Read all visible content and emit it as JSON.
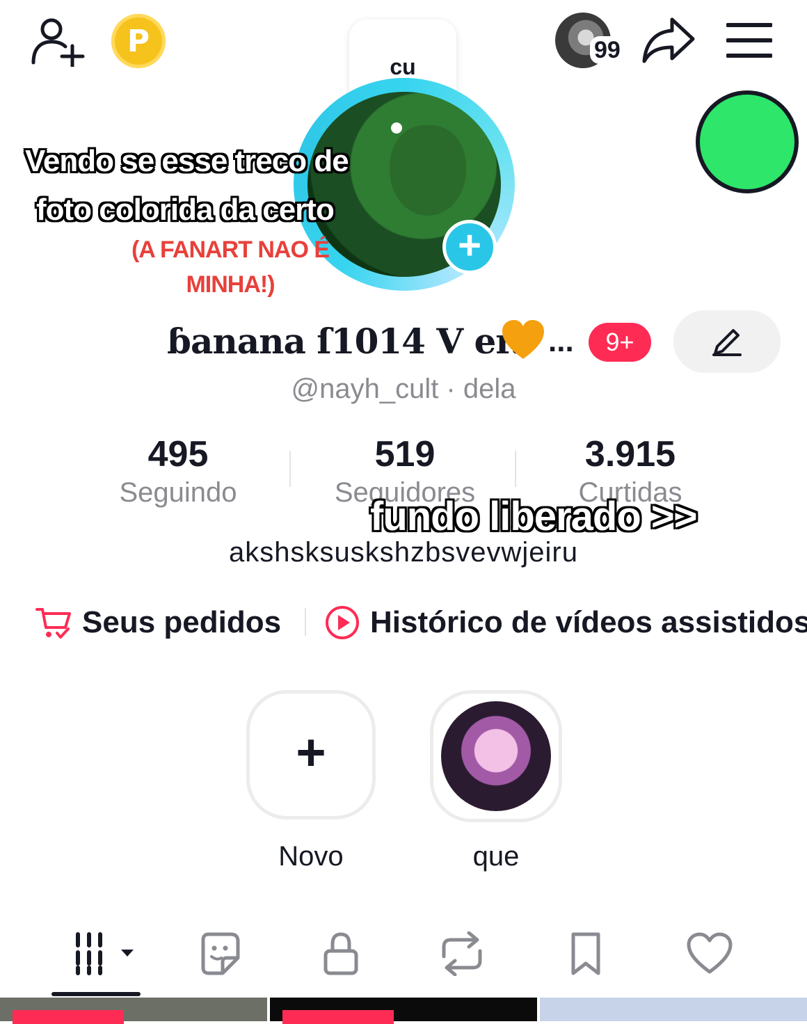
{
  "topbar": {
    "points_letter": "P",
    "friends_count": "99"
  },
  "note": {
    "text": "cu"
  },
  "overlay": {
    "caption_line1": "Vendo se esse treco de",
    "caption_line2": "foto colorida da certo",
    "caption_red": "(A FANART NAO É MINHA!)",
    "caption_fundo": "fundo liberado >>"
  },
  "profile": {
    "display_name": "ɓanana ſ1014 V er.",
    "ellipsis": "...",
    "badge": "9+",
    "handle": "@nayh_cult · dela",
    "bio": "akshsksuskshzbsvevwjeiru"
  },
  "stats": {
    "following": {
      "value": "495",
      "label": "Seguindo"
    },
    "followers": {
      "value": "519",
      "label": "Seguidores"
    },
    "likes": {
      "value": "3.915",
      "label": "Curtidas"
    }
  },
  "shortcuts": {
    "orders": "Seus pedidos",
    "history": "Histórico de vídeos assistidos"
  },
  "highlights": {
    "new_label": "Novo",
    "new_symbol": "+",
    "que_label": "que"
  },
  "icons": {
    "add_friend": "add-user-icon",
    "share": "share-icon",
    "menu": "hamburger-menu-icon",
    "edit": "pencil-icon",
    "orders": "cart-icon",
    "history": "play-circle-icon",
    "tabs": [
      "grid-icon",
      "sticker-icon",
      "lock-icon",
      "repost-icon",
      "bookmark-icon",
      "heart-icon"
    ]
  },
  "colors": {
    "accent": "#fe2c55",
    "status_dot": "#2ee66a",
    "ring": "#37d4ef",
    "points": "#f6c21c"
  }
}
